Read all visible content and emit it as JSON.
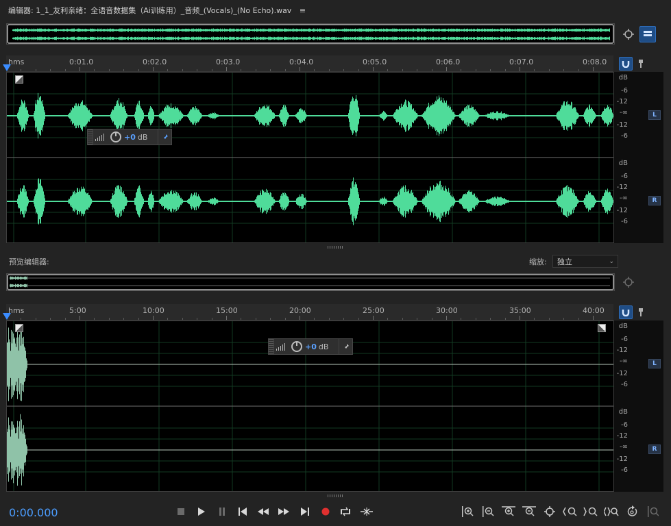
{
  "editor": {
    "title": "编辑器: 1_1_友利亲绪：全语音数据集（Ai训练用）_音频_(Vocals)_(No Echo).wav",
    "menu_glyph": "≡"
  },
  "top_ruler": {
    "unit_label": "hms",
    "ticks": [
      "0:01.0",
      "0:02.0",
      "0:03.0",
      "0:04.0",
      "0:05.0",
      "0:06.0",
      "0:07.0",
      "0:08.0"
    ]
  },
  "bottom_ruler": {
    "unit_label": "hms",
    "ticks": [
      "5:00",
      "10:00",
      "15:00",
      "20:00",
      "25:00",
      "30:00",
      "35:00",
      "40:00"
    ]
  },
  "db_scale": {
    "unit": "dB",
    "labels": [
      "-6",
      "-12",
      "-∞",
      "-12",
      "-6"
    ]
  },
  "channels": {
    "left": "L",
    "right": "R"
  },
  "hud": {
    "value": "+0",
    "unit": "dB"
  },
  "preview": {
    "label": "预览编辑器:",
    "zoom_label": "缩放:",
    "zoom_value": "独立"
  },
  "transport": {
    "timecode": "0:00.000"
  },
  "colors": {
    "waveform": "#4fdc9a",
    "waveform_preview": "#8fc2a8",
    "accent": "#4b9dff",
    "record": "#e0302f"
  },
  "icons": {
    "stop": "stop-icon",
    "play": "play-icon",
    "pause": "pause-icon",
    "skip_start": "skip-to-start-icon",
    "rewind": "rewind-icon",
    "fast_forward": "fast-forward-icon",
    "skip_end": "skip-to-end-icon",
    "record": "record-icon",
    "loop": "loop-icon",
    "skip_selection": "skip-selection-icon"
  }
}
